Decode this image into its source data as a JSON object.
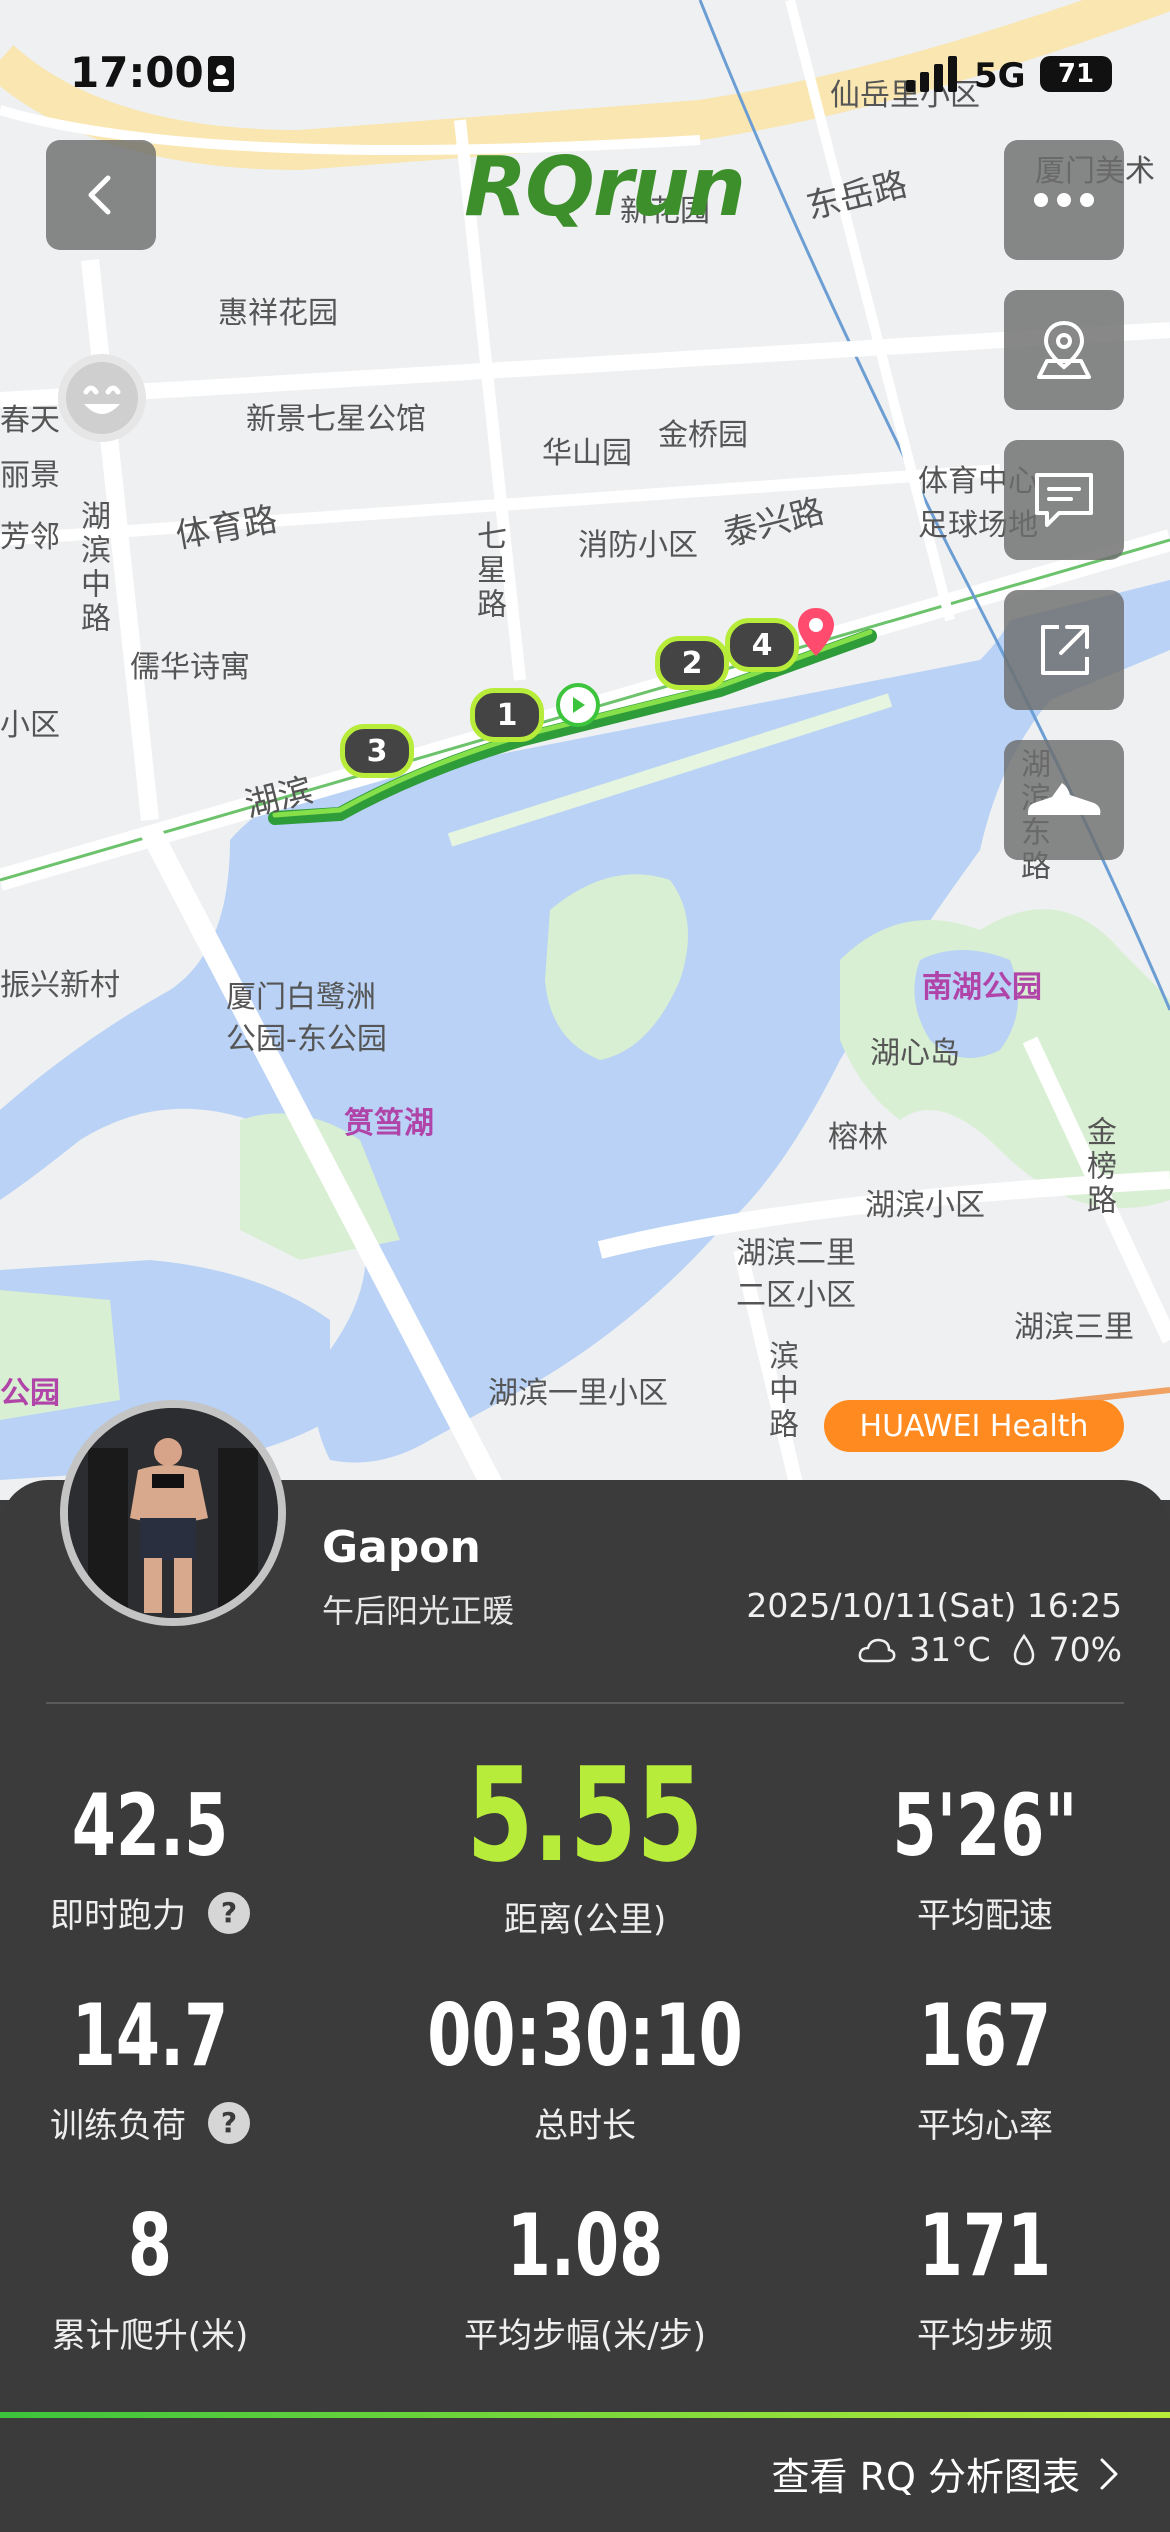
{
  "status_bar": {
    "time": "17:00",
    "network": "5G",
    "battery": "71"
  },
  "app": {
    "logo": "RQrun",
    "badge": "HUAWEI Health",
    "accent": "#b8ec3a",
    "route_color": "#3cc43c"
  },
  "map": {
    "labels": {
      "xianyueli": "仙岳里小区",
      "xiamen_art": "厦门美术",
      "donglu": "东岳路",
      "huixiang": "惠祥花园",
      "xinjing": "新景七星公馆",
      "huashan": "华山园",
      "jinqiao": "金桥园",
      "tiyulu": "体育路",
      "xiaofang": "消防小区",
      "taixinglu": "泰兴路",
      "tiyu_center": "体育中心",
      "football": "足球场地",
      "qixinglu": "七星路",
      "huaru": "儒华诗寓",
      "hubinzhonglu": "湖滨中路",
      "hubin": "湖滨",
      "zhenxing": "振兴新村",
      "bailuzhou_1": "厦门白鹭洲",
      "bailuzhou_2": "公园-东公园",
      "yundanghu": "筼筜湖",
      "nanhu": "南湖公园",
      "huxindao": "湖心岛",
      "ronglin": "榕林",
      "hubinxiaoqu": "湖滨小区",
      "hubin2_1": "湖滨二里",
      "hubin2_2": "二区小区",
      "hubin3": "湖滨三里",
      "jinbanglu": "金榜路",
      "hubin1": "湖滨一里小区",
      "binzhonglu": "滨中路",
      "gongyuan": "公园",
      "hubindonglu": "湖滨东路",
      "left1": "春天",
      "left2": "丽景",
      "left3": "芳邻",
      "left4": "小区",
      "newgarden": "新花园"
    },
    "lap_markers": [
      "1",
      "2",
      "3",
      "4"
    ]
  },
  "profile": {
    "name": "Gapon",
    "subtitle": "午后阳光正暖",
    "datetime": "2025/10/11(Sat) 16:25",
    "temperature": "31°C",
    "humidity": "70%"
  },
  "stats": [
    {
      "value": "42.5",
      "label": "即时跑力",
      "help": true
    },
    {
      "value": "5.55",
      "label": "距离(公里)",
      "highlight": true
    },
    {
      "value": "5'26\"",
      "label": "平均配速"
    },
    {
      "value": "14.7",
      "label": "训练负荷",
      "help": true
    },
    {
      "value": "00:30:10",
      "label": "总时长"
    },
    {
      "value": "167",
      "label": "平均心率"
    },
    {
      "value": "8",
      "label": "累计爬升(米)"
    },
    {
      "value": "1.08",
      "label": "平均步幅(米/步)"
    },
    {
      "value": "171",
      "label": "平均步频"
    }
  ],
  "footer": {
    "link_label": "查看 RQ 分析图表"
  },
  "icons": [
    "back-icon",
    "more-icon",
    "location-icon",
    "comment-icon",
    "share-icon",
    "shoe-icon",
    "weather-cloud-icon",
    "humidity-drop-icon",
    "help-icon",
    "chevron-right-icon"
  ]
}
